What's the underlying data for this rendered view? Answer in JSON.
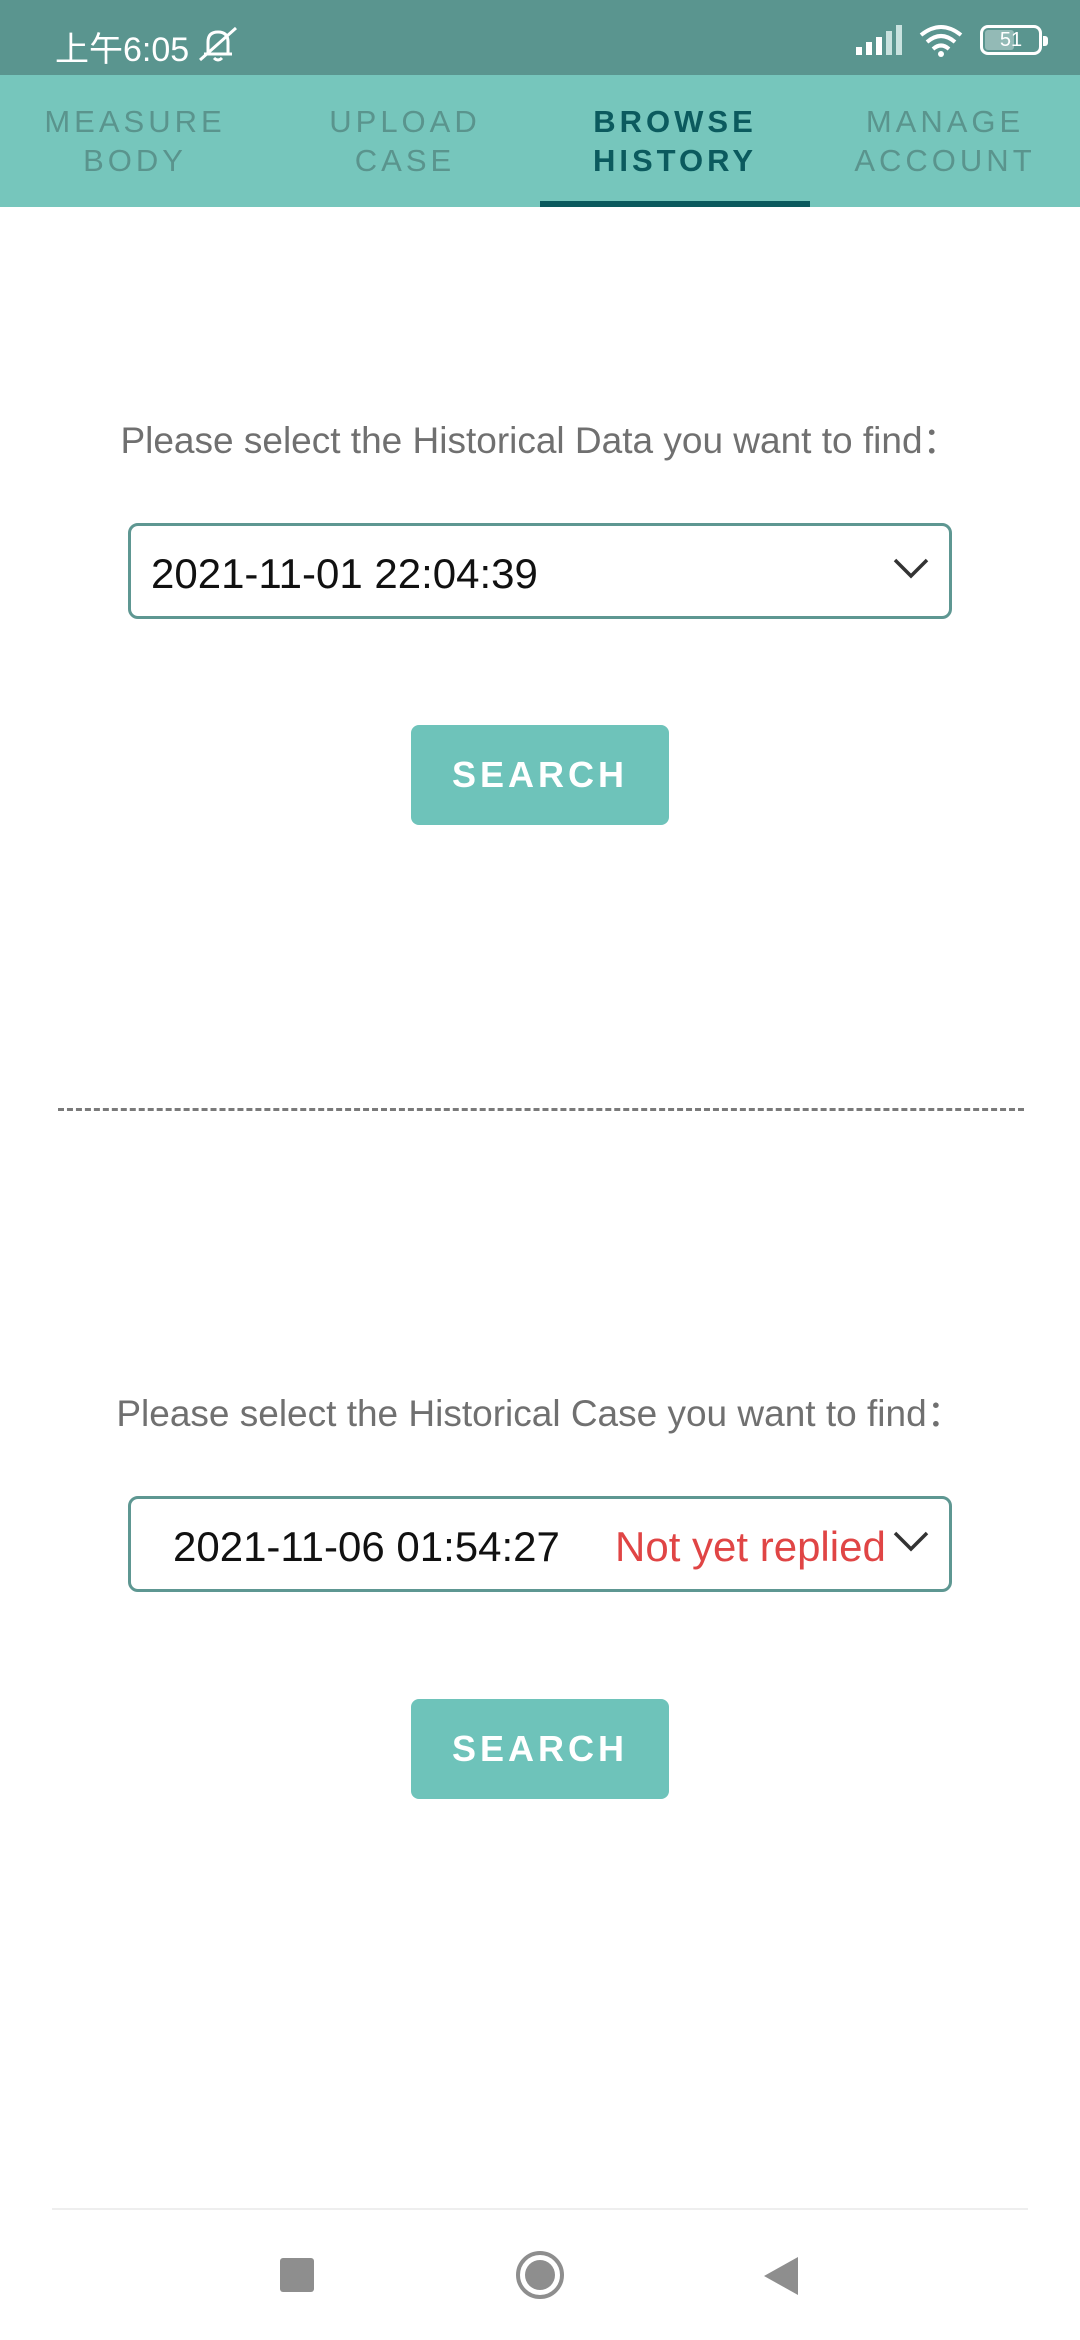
{
  "status_bar": {
    "time": "上午6:05",
    "battery": "51",
    "icons": [
      "bell-muted-icon",
      "signal-icon",
      "wifi-icon",
      "battery-icon"
    ]
  },
  "tabs": [
    {
      "label": "MEASURE\nBODY",
      "active": false
    },
    {
      "label": "UPLOAD\nCASE",
      "active": false
    },
    {
      "label": "BROWSE\nHISTORY",
      "active": true
    },
    {
      "label": "MANAGE\nACCOUNT",
      "active": false
    }
  ],
  "data_section": {
    "prompt": "Please select the Historical Data you want to find：",
    "selected": "2021-11-01 22:04:39",
    "search_label": "SEARCH"
  },
  "case_section": {
    "prompt": "Please select the Historical Case you want to find：",
    "selected": "2021-11-06 01:54:27",
    "status": "Not yet replied",
    "search_label": "SEARCH"
  },
  "colors": {
    "status_bar": "#5a958f",
    "tab_bar": "#76c6bc",
    "active_tab": "#0b5a5e",
    "button": "#6ec3ba",
    "status_red": "#e04545"
  }
}
